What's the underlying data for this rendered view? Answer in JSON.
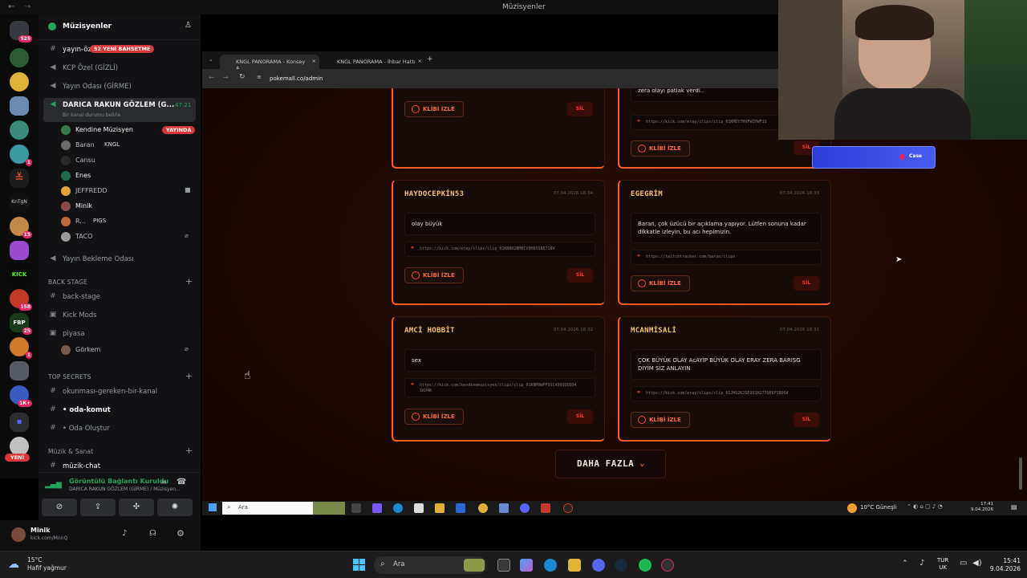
{
  "window": {
    "title": "Müzisyenler"
  },
  "server_rail": {
    "badges": [
      "525",
      "1",
      "15",
      "158",
      "25",
      "1K+",
      "1",
      "1",
      "1"
    ],
    "new_label": "YENİ"
  },
  "sidebar": {
    "guild_name": "Müzisyenler",
    "channels": [
      {
        "label": "yayın-öz",
        "badge": "52 YENİ BAHSETME"
      },
      {
        "label": "KCP Özel (GİZLİ)"
      },
      {
        "label": "Yayın Odası (GİRME)"
      },
      {
        "label": "DARICA RAKUN GÖZLEM (G...",
        "timer": "47:21",
        "status": "Bir kanal durumu belirle"
      }
    ],
    "voice_users": [
      {
        "name": "Kendine Müzisyen",
        "tag": "YAYINDA"
      },
      {
        "name": "Baran",
        "suffix": "KNGL"
      },
      {
        "name": "Cansu"
      },
      {
        "name": "Enes"
      },
      {
        "name": "JEFFREDD"
      },
      {
        "name": "Minik"
      },
      {
        "name": "R...",
        "suffix": "PIGS"
      },
      {
        "name": "TACO"
      }
    ],
    "waiting_room": "Yayın Bekleme Odası",
    "backstage": {
      "title": "BACK STAGE",
      "items": [
        "back-stage",
        "Kick Mods",
        "piyasa"
      ],
      "user": "Görkem"
    },
    "top_secrets": {
      "title": "TOP SECRETS",
      "items": [
        "okunması-gereken-bir-kanal",
        "• oda-komut",
        "• Oda Oluştur"
      ]
    },
    "music": {
      "title": "Müzik & Sanat",
      "items": [
        "müzik-chat"
      ]
    },
    "voice_panel": {
      "status": "Görüntülü Bağlantı Kuruldu",
      "channel": "DARICA RAKUN GÖZLEM (GİRME) / Müzisyen..."
    },
    "user_panel": {
      "name": "Minik",
      "status": "kick.com/MnnQ"
    }
  },
  "browser": {
    "tabs": [
      "KNGL PANORAMA - Konsey A...",
      "KNGL PANORAMA - İhbar Hattı"
    ],
    "url": "pokemall.co/admin"
  },
  "clips": [
    {
      "user": "",
      "date": "",
      "message": "",
      "link": "",
      "watch": "KLİBİ İZLE",
      "delete": "SİL"
    },
    {
      "user": "",
      "date": "",
      "message": "zera olayı patlak verdi..",
      "link": "https://kick.com/eray/clips/clip_01KMDY7HVFWZVWF1S",
      "watch": "KLİBİ İZLE",
      "delete": "SİL"
    },
    {
      "user": "HAYDOCEPKİN53",
      "date": "07.04.2026 18:34",
      "message": "olay büyük",
      "link": "https://kick.com/eray/clips/clip_01KNBR2BM0CV9H8XS8E718V",
      "watch": "KLİBİ İZLE",
      "delete": "SİL"
    },
    {
      "user": "EGEGRİM",
      "date": "07.04.2026 18:33",
      "message": "Baran, çok üzücü bir açıklama yapıyor. Lütfen sonuna kadar dikkatle izleyin, bu acı hepimizin.",
      "link": "https://twitchtracker.com/baran/clips",
      "watch": "KLİBİ İZLE",
      "delete": "SİL"
    },
    {
      "user": "AMCİ HOBBİT",
      "date": "07.04.2026 18:32",
      "message": "sex",
      "link": "https://kick.com/kendinemuzisyen/clips/clip_01KNM9WPF3SC4993QQQ94 SKU4K",
      "watch": "KLİBİ İZLE",
      "delete": "SİL"
    },
    {
      "user": "MCANMİSALİ",
      "date": "07.04.2026 18:31",
      "message": "ÇOK BÜYÜK OLAY AcAYİP BÜYÜK OLAY ERAY ZERA BARISG DİYİM SİZ ANLAYIN",
      "link": "https://kick.com/eray/clips/clip_01JHG2K2SE991H277QE6F3B0S4",
      "watch": "KLİBİ İZLE",
      "delete": "SİL"
    }
  ],
  "load_more": "DAHA FAZLA",
  "inner_taskbar": {
    "search": "Ara",
    "weather": "10°C Güneşli",
    "time": "17:41",
    "date": "9.04.2026"
  },
  "overlay_label": "Case",
  "taskbar": {
    "weather_temp": "15°C",
    "weather_desc": "Hafif yağmur",
    "search": "Ara",
    "lang_top": "TUR",
    "lang_bottom": "UK",
    "time": "15:41",
    "date": "9.04.2026"
  },
  "colors": {
    "accent": "#ff5a1f",
    "username": "#f5c16c",
    "discord_bg": "#121214"
  }
}
